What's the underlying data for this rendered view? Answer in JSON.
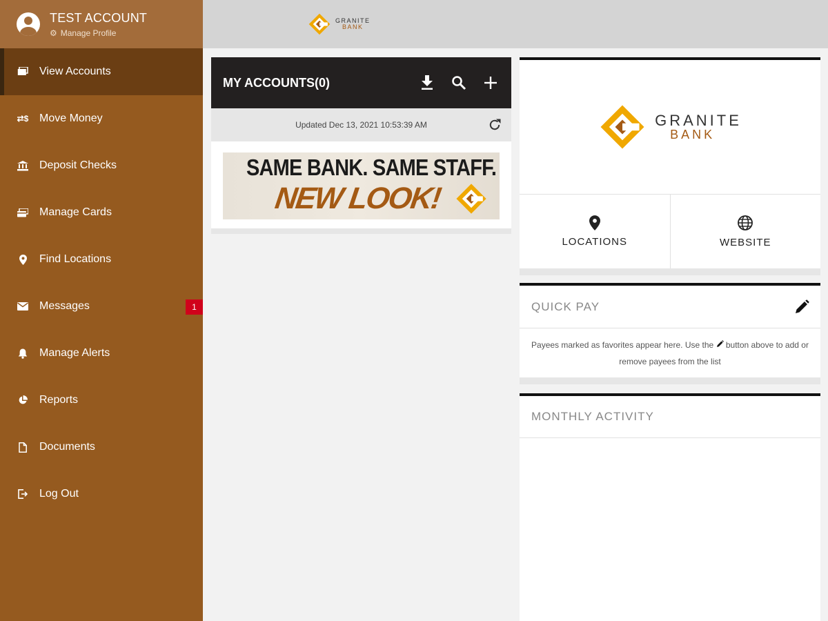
{
  "profile": {
    "name": "TEST ACCOUNT",
    "manage_label": "Manage Profile"
  },
  "nav": {
    "items": [
      {
        "label": "View Accounts",
        "icon": "accounts-icon"
      },
      {
        "label": "Move Money",
        "icon": "transfer-money-icon"
      },
      {
        "label": "Deposit Checks",
        "icon": "bank-building-icon"
      },
      {
        "label": "Manage Cards",
        "icon": "cards-icon"
      },
      {
        "label": "Find Locations",
        "icon": "location-pin-icon"
      },
      {
        "label": "Messages",
        "icon": "envelope-icon",
        "badge": "1"
      },
      {
        "label": "Manage Alerts",
        "icon": "bell-icon"
      },
      {
        "label": "Reports",
        "icon": "pie-chart-icon"
      },
      {
        "label": "Documents",
        "icon": "document-icon"
      },
      {
        "label": "Log Out",
        "icon": "logout-icon"
      }
    ],
    "active": "View Accounts"
  },
  "brand": {
    "word1": "GRANITE",
    "word2": "BANK",
    "colors": {
      "gold": "#f0a800",
      "brown": "#a45a14",
      "sidebar": "#955a1f",
      "sidebar_active": "#6b3e13",
      "header_dark": "#232020",
      "badge": "#d0021b"
    }
  },
  "accounts": {
    "title": "MY ACCOUNTS(0)",
    "updated": "Updated Dec 13, 2021 10:53:39 AM",
    "banner": {
      "line1": "SAME BANK. SAME STAFF.",
      "line2": "NEW LOOK!"
    }
  },
  "links": {
    "locations": "LOCATIONS",
    "website": "WEBSITE"
  },
  "quickpay": {
    "title": "QUICK PAY",
    "text_before": "Payees marked as favorites appear here. Use the",
    "text_after": "button above to add or remove payees from the list"
  },
  "monthly": {
    "title": "MONTHLY ACTIVITY"
  }
}
